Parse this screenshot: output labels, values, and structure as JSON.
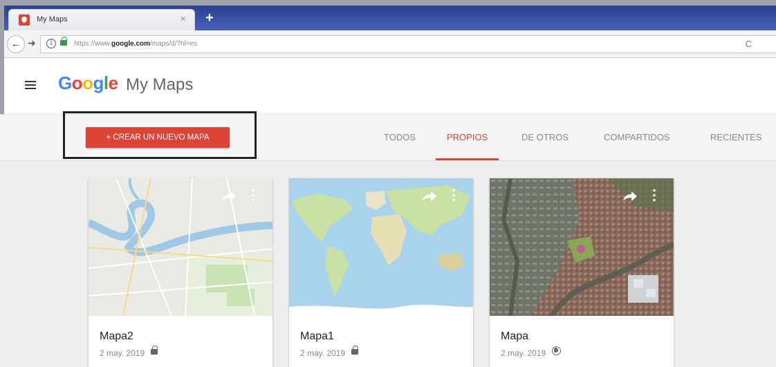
{
  "browser": {
    "tab_title": "My Maps",
    "tab_close": "×",
    "new_tab": "+",
    "url_prefix": "https://www.",
    "url_domain": "google.com",
    "url_path": "/maps/d/?hl=es",
    "reload": "C"
  },
  "header": {
    "logo": [
      "G",
      "o",
      "o",
      "g",
      "l",
      "e"
    ],
    "logo_colors": [
      "#4285f4",
      "#ea4335",
      "#fbbc05",
      "#4285f4",
      "#34a853",
      "#ea4335"
    ],
    "title": "My Maps"
  },
  "toolbar": {
    "create_label": "+ CREAR UN NUEVO MAPA",
    "tabs": [
      {
        "label": "TODOS",
        "active": false
      },
      {
        "label": "PROPIOS",
        "active": true
      },
      {
        "label": "DE OTROS",
        "active": false
      },
      {
        "label": "COMPARTIDOS",
        "active": false
      },
      {
        "label": "RECIENTES",
        "active": false
      }
    ]
  },
  "maps": [
    {
      "title": "Mapa2",
      "date": "2 may. 2019",
      "visibility": "lock-icon"
    },
    {
      "title": "Mapa1",
      "date": "2 may. 2019",
      "visibility": "lock-icon"
    },
    {
      "title": "Mapa",
      "date": "2 may. 2019",
      "visibility": "globe-icon"
    }
  ],
  "colors": {
    "accent": "#db4437",
    "browser_bar": "#3c53a8"
  }
}
